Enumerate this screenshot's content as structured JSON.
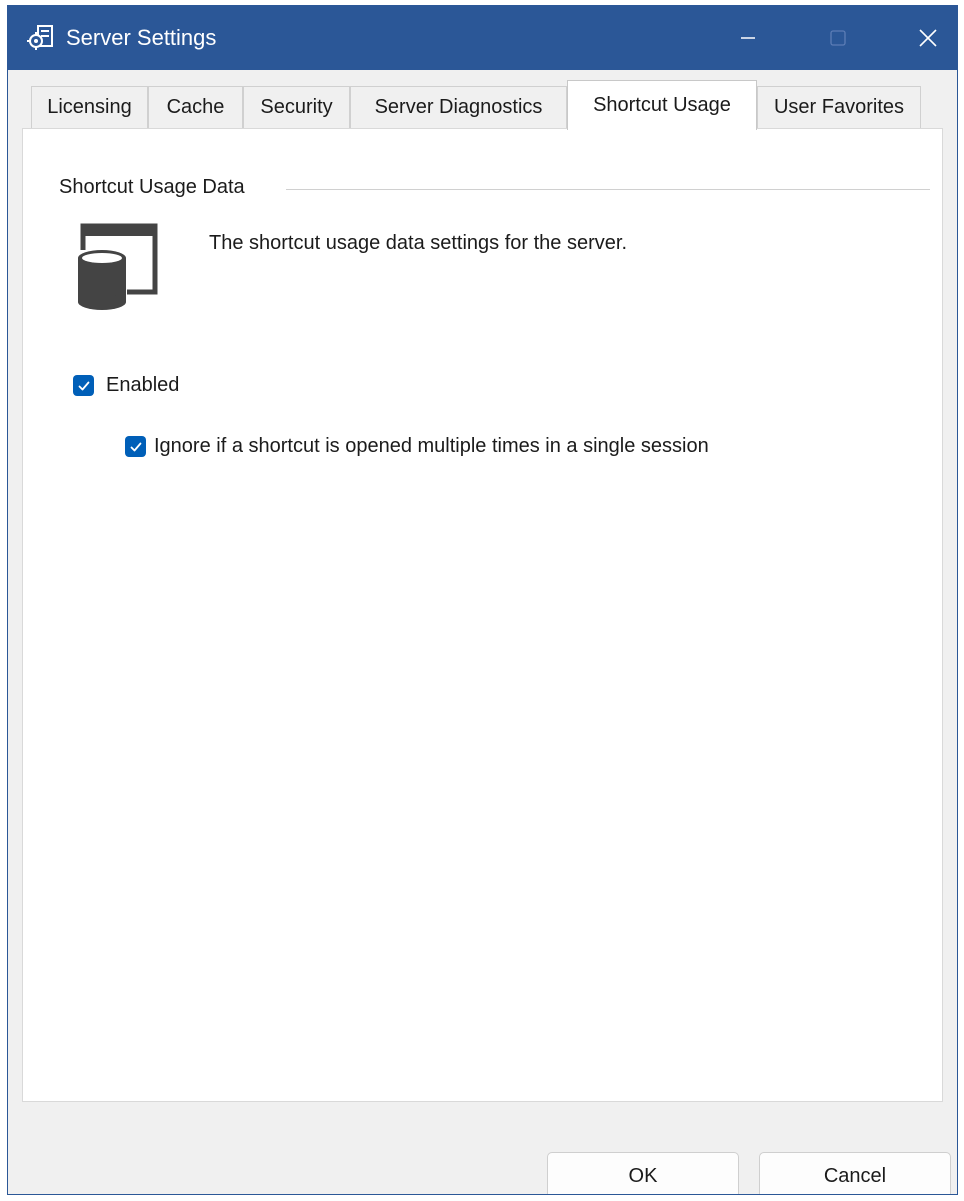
{
  "window": {
    "title": "Server Settings",
    "accent_color": "#2b5797"
  },
  "tabs": [
    {
      "label": "Licensing",
      "active": false
    },
    {
      "label": "Cache",
      "active": false
    },
    {
      "label": "Security",
      "active": false
    },
    {
      "label": "Server Diagnostics",
      "active": false
    },
    {
      "label": "Shortcut Usage",
      "active": true
    },
    {
      "label": "User Favorites",
      "active": false
    }
  ],
  "section": {
    "title": "Shortcut Usage Data",
    "icon": "database-window-icon",
    "description": "The shortcut usage data settings for the server."
  },
  "options": {
    "enabled": {
      "label": "Enabled",
      "checked": true
    },
    "ignore_repeat": {
      "label": "Ignore if a shortcut is opened multiple times in a single session",
      "checked": true
    }
  },
  "buttons": {
    "ok": "OK",
    "cancel": "Cancel"
  },
  "checkbox_color": "#005fb8"
}
